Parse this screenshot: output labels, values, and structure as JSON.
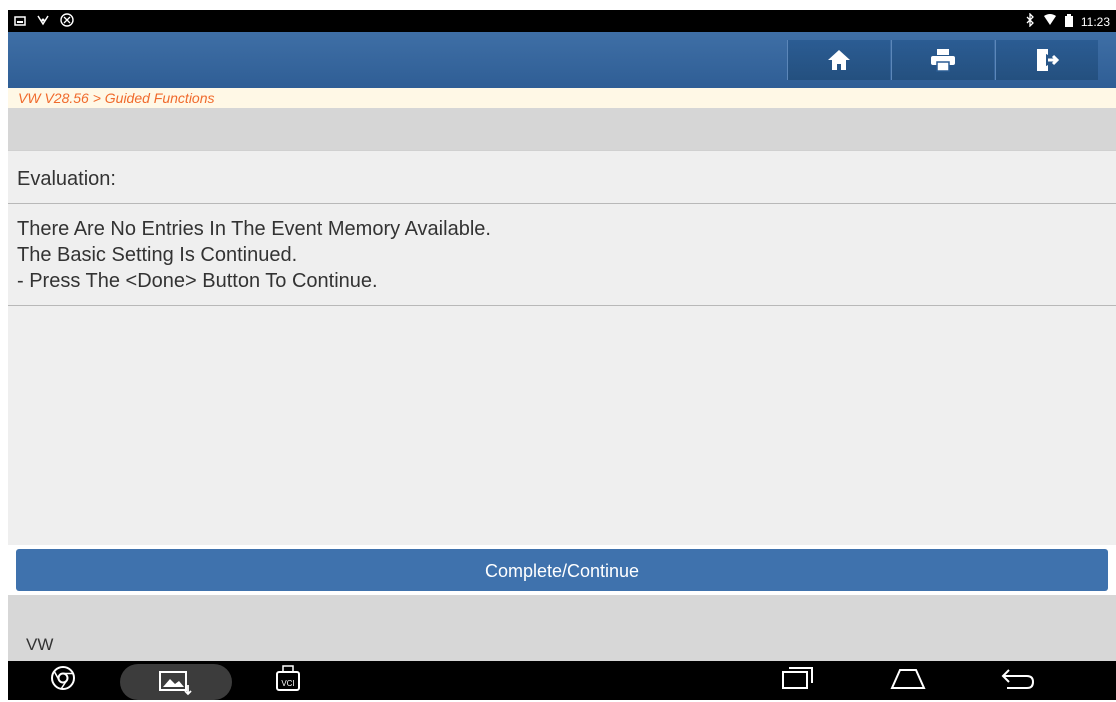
{
  "status": {
    "time": "11:23"
  },
  "breadcrumb": "VW V28.56 > Guided Functions",
  "evaluation": {
    "label": "Evaluation:",
    "lines": [
      "There Are No Entries In The Event Memory Available.",
      "The Basic Setting Is Continued.",
      "- Press The <Done> Button To Continue."
    ]
  },
  "actions": {
    "complete_label": "Complete/Continue"
  },
  "footer": {
    "label": "VW"
  },
  "icons": {
    "status_left": [
      "screenshot-icon",
      "usb-debug-icon",
      "vpn-icon"
    ],
    "status_right": [
      "bluetooth-icon",
      "wifi-icon",
      "battery-icon"
    ],
    "header": [
      "home-icon",
      "print-icon",
      "exit-icon"
    ],
    "nav": [
      "chrome-icon",
      "gallery-download-icon",
      "vci-icon",
      "recent-apps-icon",
      "home-nav-icon",
      "back-icon"
    ]
  },
  "colors": {
    "header": "#3a6aa2",
    "button": "#3f72ad",
    "breadcrumb_text": "#f06a2c"
  }
}
